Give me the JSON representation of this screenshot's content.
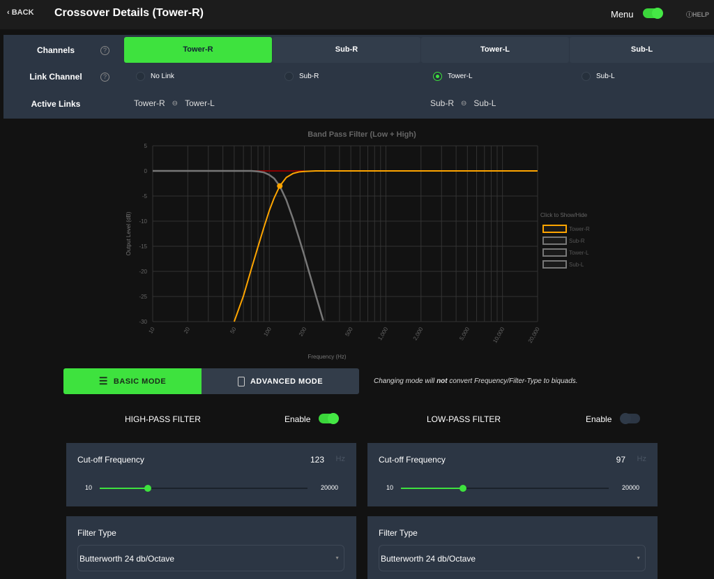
{
  "header": {
    "back_label": "BACK",
    "title": "Crossover Details (Tower-R)",
    "menu_label": "Menu",
    "menu_on": true,
    "help_label": "HELP"
  },
  "channels": {
    "label": "Channels",
    "tabs": [
      "Tower-R",
      "Sub-R",
      "Tower-L",
      "Sub-L"
    ],
    "active": "Tower-R"
  },
  "link_channel": {
    "label": "Link Channel",
    "options": [
      "No Link",
      "Sub-R",
      "Tower-L",
      "Sub-L"
    ],
    "selected": "Tower-L"
  },
  "active_links": {
    "label": "Active Links",
    "pairs": [
      [
        "Tower-R",
        "Tower-L"
      ],
      [
        "Sub-R",
        "Sub-L"
      ]
    ]
  },
  "colors": {
    "accent": "#3ee23e",
    "panel": "#2c3644",
    "tower_r": "#ffa500",
    "other_series": "#777777",
    "reference": "#8b0000"
  },
  "chart_data": {
    "type": "line",
    "title": "Band Pass Filter (Low + High)",
    "xlabel": "Frequency (Hz)",
    "ylabel": "Output Level (dB)",
    "xscale": "log",
    "xlim": [
      10,
      20000
    ],
    "ylim": [
      -30,
      5
    ],
    "xticks": [
      "10",
      "20",
      "50",
      "100",
      "200",
      "500",
      "1,000",
      "2,000",
      "5,000",
      "10,000",
      "20,000"
    ],
    "yticks": [
      "5",
      "0",
      "-5",
      "-10",
      "-15",
      "-20",
      "-25",
      "-30"
    ],
    "grid": true,
    "legend_title": "Click to Show/Hide",
    "legend_position": "right",
    "series": [
      {
        "name": "Tower-R",
        "color": "#ffa500",
        "visible": true,
        "x": [
          50,
          60,
          70,
          80,
          90,
          100,
          110,
          123,
          140,
          160,
          180,
          200,
          250,
          500,
          1000,
          5000,
          20000
        ],
        "y": [
          -31.3,
          -24.9,
          -19.6,
          -15.1,
          -11.2,
          -7.9,
          -5.4,
          -3.0,
          -1.3,
          -0.5,
          -0.2,
          -0.1,
          0,
          0,
          0,
          0,
          0
        ]
      },
      {
        "name": "Sub-R",
        "color": "#777777",
        "visible": true,
        "x": [
          10,
          20,
          50,
          70,
          80,
          90,
          100,
          110,
          123,
          140,
          160,
          180,
          200,
          250,
          290
        ],
        "y": [
          0,
          0,
          0,
          0,
          -0.1,
          -0.3,
          -0.8,
          -1.5,
          -3.0,
          -5.8,
          -9.6,
          -13.4,
          -16.9,
          -24.7,
          -29.8
        ]
      },
      {
        "name": "Tower-L",
        "color": "#777777",
        "visible": false,
        "x": [],
        "y": []
      },
      {
        "name": "Sub-L",
        "color": "#777777",
        "visible": false,
        "x": [],
        "y": []
      }
    ],
    "marker": {
      "x": 123,
      "y": -3.0
    }
  },
  "mode": {
    "basic_label": "BASIC MODE",
    "advanced_label": "ADVANCED MODE",
    "active": "basic",
    "note_pre": "Changing mode will ",
    "note_bold": "not",
    "note_post": " convert Frequency/Filter-Type to biquads."
  },
  "high_pass": {
    "title": "HIGH-PASS FILTER",
    "enable_label": "Enable",
    "enabled": true,
    "cutoff_label": "Cut-off Frequency",
    "cutoff": "123",
    "unit": "Hz",
    "min": "10",
    "max": "20000",
    "slider_percent": 23,
    "filter_type_label": "Filter Type",
    "filter_type": "Butterworth 24 db/Octave"
  },
  "low_pass": {
    "title": "LOW-PASS FILTER",
    "enable_label": "Enable",
    "enabled": false,
    "cutoff_label": "Cut-off Frequency",
    "cutoff": "97",
    "unit": "Hz",
    "min": "10",
    "max": "20000",
    "slider_percent": 30,
    "filter_type_label": "Filter Type",
    "filter_type": "Butterworth 24 db/Octave"
  }
}
